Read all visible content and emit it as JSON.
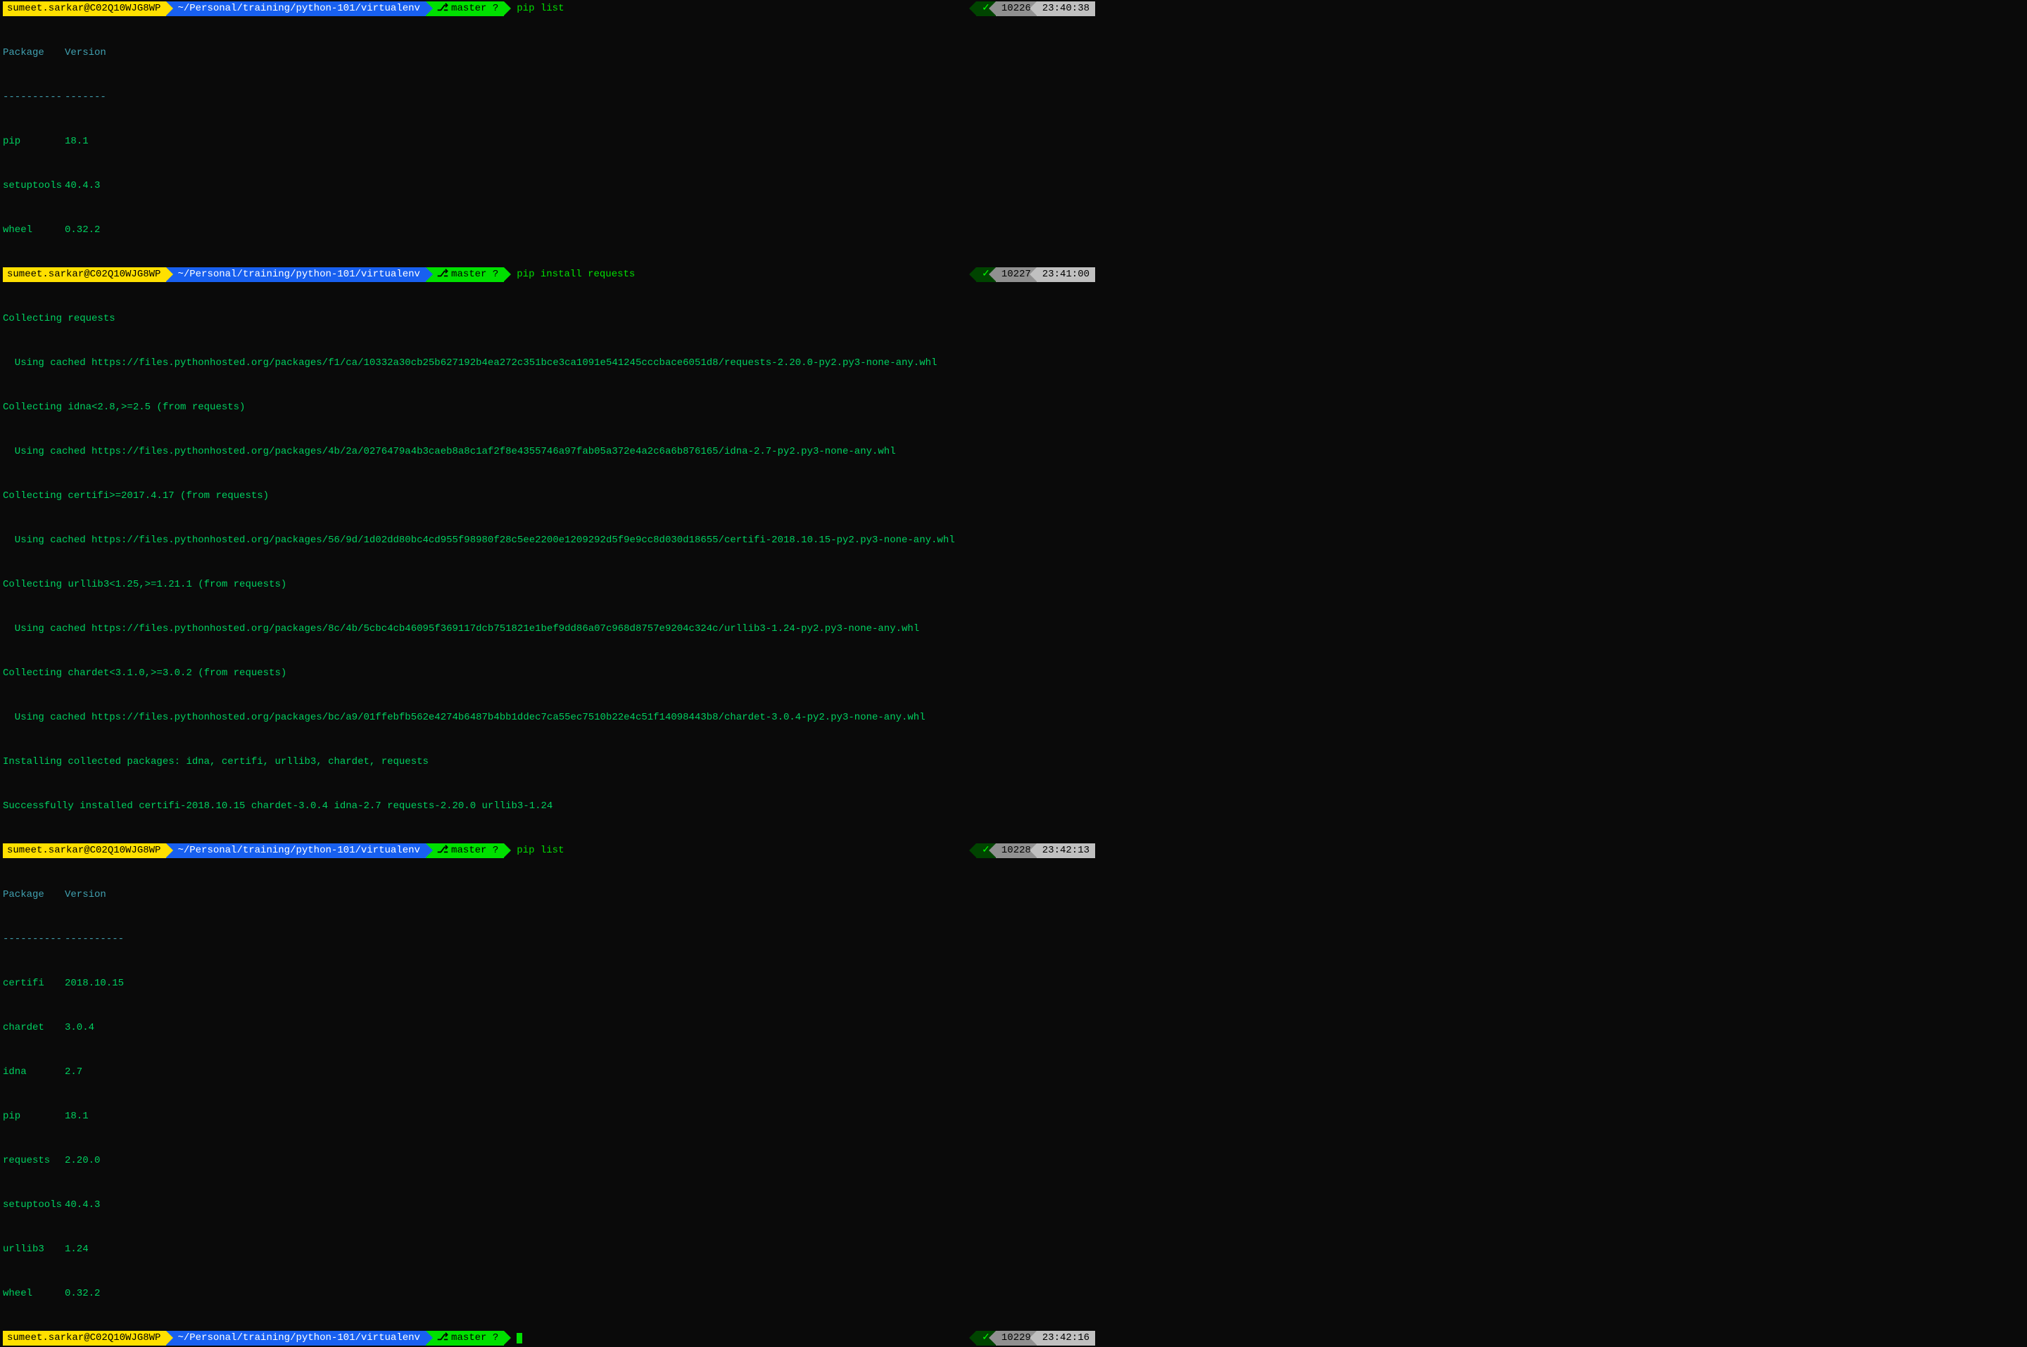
{
  "user_host": "sumeet.sarkar@C02Q10WJG8WP",
  "path": "~/Personal/training/python-101/virtualenv",
  "git_branch": "master ?",
  "check": "✓",
  "prompts": [
    {
      "cmd": "pip list",
      "num": "10226",
      "time": "23:40:38"
    },
    {
      "cmd": "pip install requests",
      "num": "10227",
      "time": "23:41:00"
    },
    {
      "cmd": "pip list",
      "num": "10228",
      "time": "23:42:13"
    },
    {
      "cmd": "",
      "num": "10229",
      "time": "23:42:16"
    }
  ],
  "list1": {
    "header_pkg": "Package",
    "header_ver": "Version",
    "dash_pkg": "----------",
    "dash_ver": "-------",
    "rows": [
      {
        "pkg": "pip",
        "ver": "18.1"
      },
      {
        "pkg": "setuptools",
        "ver": "40.4.3"
      },
      {
        "pkg": "wheel",
        "ver": "0.32.2"
      }
    ]
  },
  "install_output": [
    "Collecting requests",
    "  Using cached https://files.pythonhosted.org/packages/f1/ca/10332a30cb25b627192b4ea272c351bce3ca1091e541245cccbace6051d8/requests-2.20.0-py2.py3-none-any.whl",
    "Collecting idna<2.8,>=2.5 (from requests)",
    "  Using cached https://files.pythonhosted.org/packages/4b/2a/0276479a4b3caeb8a8c1af2f8e4355746a97fab05a372e4a2c6a6b876165/idna-2.7-py2.py3-none-any.whl",
    "Collecting certifi>=2017.4.17 (from requests)",
    "  Using cached https://files.pythonhosted.org/packages/56/9d/1d02dd80bc4cd955f98980f28c5ee2200e1209292d5f9e9cc8d030d18655/certifi-2018.10.15-py2.py3-none-any.whl",
    "Collecting urllib3<1.25,>=1.21.1 (from requests)",
    "  Using cached https://files.pythonhosted.org/packages/8c/4b/5cbc4cb46095f369117dcb751821e1bef9dd86a07c968d8757e9204c324c/urllib3-1.24-py2.py3-none-any.whl",
    "Collecting chardet<3.1.0,>=3.0.2 (from requests)",
    "  Using cached https://files.pythonhosted.org/packages/bc/a9/01ffebfb562e4274b6487b4bb1ddec7ca55ec7510b22e4c51f14098443b8/chardet-3.0.4-py2.py3-none-any.whl",
    "Installing collected packages: idna, certifi, urllib3, chardet, requests",
    "Successfully installed certifi-2018.10.15 chardet-3.0.4 idna-2.7 requests-2.20.0 urllib3-1.24"
  ],
  "list2": {
    "header_pkg": "Package",
    "header_ver": "Version",
    "dash_pkg": "----------",
    "dash_ver": "----------",
    "rows": [
      {
        "pkg": "certifi",
        "ver": "2018.10.15"
      },
      {
        "pkg": "chardet",
        "ver": "3.0.4"
      },
      {
        "pkg": "idna",
        "ver": "2.7"
      },
      {
        "pkg": "pip",
        "ver": "18.1"
      },
      {
        "pkg": "requests",
        "ver": "2.20.0"
      },
      {
        "pkg": "setuptools",
        "ver": "40.4.3"
      },
      {
        "pkg": "urllib3",
        "ver": "1.24"
      },
      {
        "pkg": "wheel",
        "ver": "0.32.2"
      }
    ]
  }
}
